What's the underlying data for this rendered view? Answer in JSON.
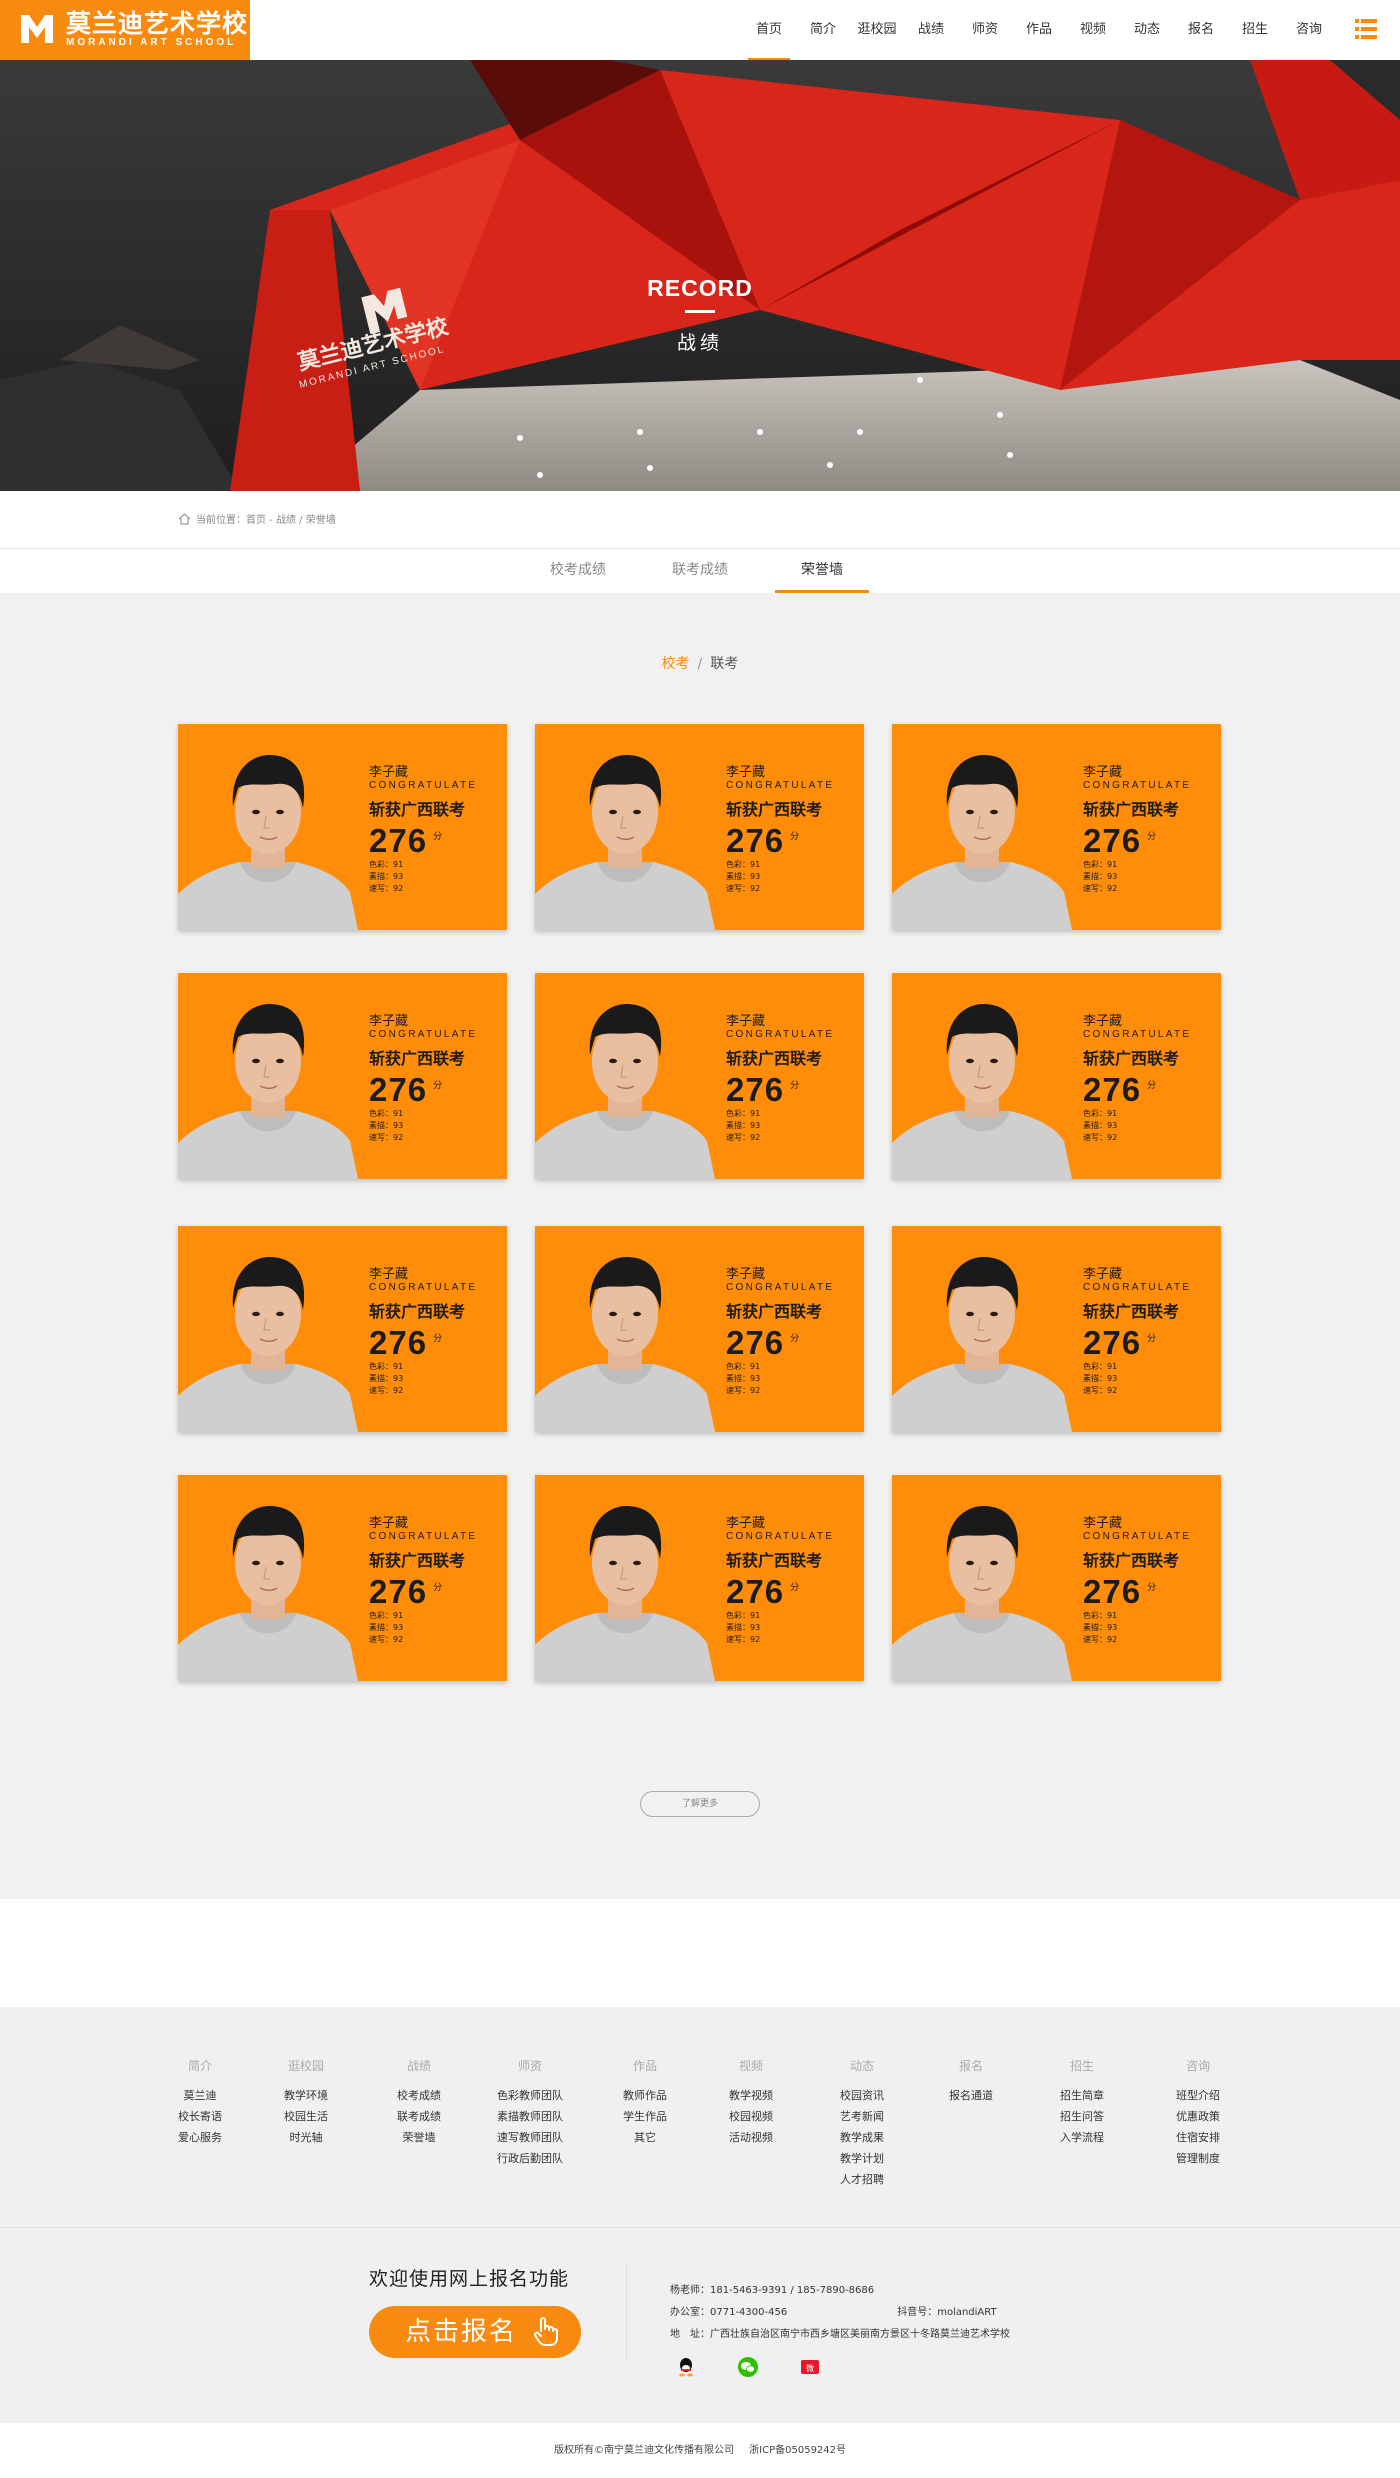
{
  "header": {
    "logo_cn": "莫兰迪艺术学校",
    "logo_en": "MORANDI ART SCHOOL",
    "nav": [
      "首页",
      "简介",
      "逛校园",
      "战绩",
      "师资",
      "作品",
      "视频",
      "动态",
      "报名",
      "招生",
      "咨询"
    ],
    "active_nav": "首页"
  },
  "banner": {
    "title": "RECORD",
    "subtitle": "战绩",
    "sign_cn": "莫兰迪艺术学校",
    "sign_en": "MORANDI ART SCHOOL"
  },
  "breadcrumb": "当前位置：首页 - 战绩 / 荣誉墙",
  "tabs": [
    "校考成绩",
    "联考成绩",
    "荣誉墙"
  ],
  "active_tab": "荣誉墙",
  "subnav": {
    "active": "校考",
    "separator": "/",
    "other": "联考"
  },
  "cards": [
    {
      "name": "李子藏",
      "congrats": "CONGRATULATE",
      "headline": "斩获广西联考",
      "score": "276",
      "unit": "分",
      "lines": [
        "色彩：91",
        "素描：93",
        "速写：92"
      ]
    },
    {
      "name": "李子藏",
      "congrats": "CONGRATULATE",
      "headline": "斩获广西联考",
      "score": "276",
      "unit": "分",
      "lines": [
        "色彩：91",
        "素描：93",
        "速写：92"
      ]
    },
    {
      "name": "李子藏",
      "congrats": "CONGRATULATE",
      "headline": "斩获广西联考",
      "score": "276",
      "unit": "分",
      "lines": [
        "色彩：91",
        "素描：93",
        "速写：92"
      ]
    },
    {
      "name": "李子藏",
      "congrats": "CONGRATULATE",
      "headline": "斩获广西联考",
      "score": "276",
      "unit": "分",
      "lines": [
        "色彩：91",
        "素描：93",
        "速写：92"
      ]
    },
    {
      "name": "李子藏",
      "congrats": "CONGRATULATE",
      "headline": "斩获广西联考",
      "score": "276",
      "unit": "分",
      "lines": [
        "色彩：91",
        "素描：93",
        "速写：92"
      ]
    },
    {
      "name": "李子藏",
      "congrats": "CONGRATULATE",
      "headline": "斩获广西联考",
      "score": "276",
      "unit": "分",
      "lines": [
        "色彩：91",
        "素描：93",
        "速写：92"
      ]
    },
    {
      "name": "李子藏",
      "congrats": "CONGRATULATE",
      "headline": "斩获广西联考",
      "score": "276",
      "unit": "分",
      "lines": [
        "色彩：91",
        "素描：93",
        "速写：92"
      ]
    },
    {
      "name": "李子藏",
      "congrats": "CONGRATULATE",
      "headline": "斩获广西联考",
      "score": "276",
      "unit": "分",
      "lines": [
        "色彩：91",
        "素描：93",
        "速写：92"
      ]
    },
    {
      "name": "李子藏",
      "congrats": "CONGRATULATE",
      "headline": "斩获广西联考",
      "score": "276",
      "unit": "分",
      "lines": [
        "色彩：91",
        "素描：93",
        "速写：92"
      ]
    },
    {
      "name": "李子藏",
      "congrats": "CONGRATULATE",
      "headline": "斩获广西联考",
      "score": "276",
      "unit": "分",
      "lines": [
        "色彩：91",
        "素描：93",
        "速写：92"
      ]
    },
    {
      "name": "李子藏",
      "congrats": "CONGRATULATE",
      "headline": "斩获广西联考",
      "score": "276",
      "unit": "分",
      "lines": [
        "色彩：91",
        "素描：93",
        "速写：92"
      ]
    },
    {
      "name": "李子藏",
      "congrats": "CONGRATULATE",
      "headline": "斩获广西联考",
      "score": "276",
      "unit": "分",
      "lines": [
        "色彩：91",
        "素描：93",
        "速写：92"
      ]
    }
  ],
  "more_button": "了解更多",
  "footer": {
    "columns": [
      {
        "title": "简介",
        "items": [
          "莫兰迪",
          "校长寄语",
          "爱心服务"
        ]
      },
      {
        "title": "逛校园",
        "items": [
          "教学环境",
          "校园生活",
          "时光轴"
        ]
      },
      {
        "title": "战绩",
        "items": [
          "校考成绩",
          "联考成绩",
          "荣誉墙"
        ]
      },
      {
        "title": "师资",
        "items": [
          "色彩教师团队",
          "素描教师团队",
          "速写教师团队",
          "行政后勤团队"
        ]
      },
      {
        "title": "作品",
        "items": [
          "教师作品",
          "学生作品",
          "其它"
        ]
      },
      {
        "title": "视频",
        "items": [
          "教学视频",
          "校园视频",
          "活动视频"
        ]
      },
      {
        "title": "动态",
        "items": [
          "校园资讯",
          "艺考新闻",
          "教学成果",
          "教学计划",
          "人才招聘"
        ]
      },
      {
        "title": "报名",
        "items": [
          "报名通道"
        ]
      },
      {
        "title": "招生",
        "items": [
          "招生简章",
          "招生问答",
          "入学流程"
        ]
      },
      {
        "title": "咨询",
        "items": [
          "班型介绍",
          "优惠政策",
          "住宿安排",
          "管理制度"
        ]
      }
    ],
    "welcome": "欢迎使用网上报名功能",
    "signup": "点击报名",
    "teacher": "杨老师：181-5463-9391 / 185-7890-8686",
    "office": "办公室：0771-4300-456",
    "douyin": "抖音号：molandiART",
    "address": "地　址：广西壮族自治区南宁市西乡塘区美丽南方景区十冬路莫兰迪艺术学校",
    "social": [
      "qq-icon",
      "wechat-icon",
      "weibo-icon"
    ],
    "copyright": "版权所有©南宁莫兰迪文化传播有限公司",
    "icp": "浙ICP备05059242号"
  },
  "colors": {
    "accent": "#f88a0f",
    "card": "#ff8d0a",
    "content_bg": "#f1f1f1"
  }
}
